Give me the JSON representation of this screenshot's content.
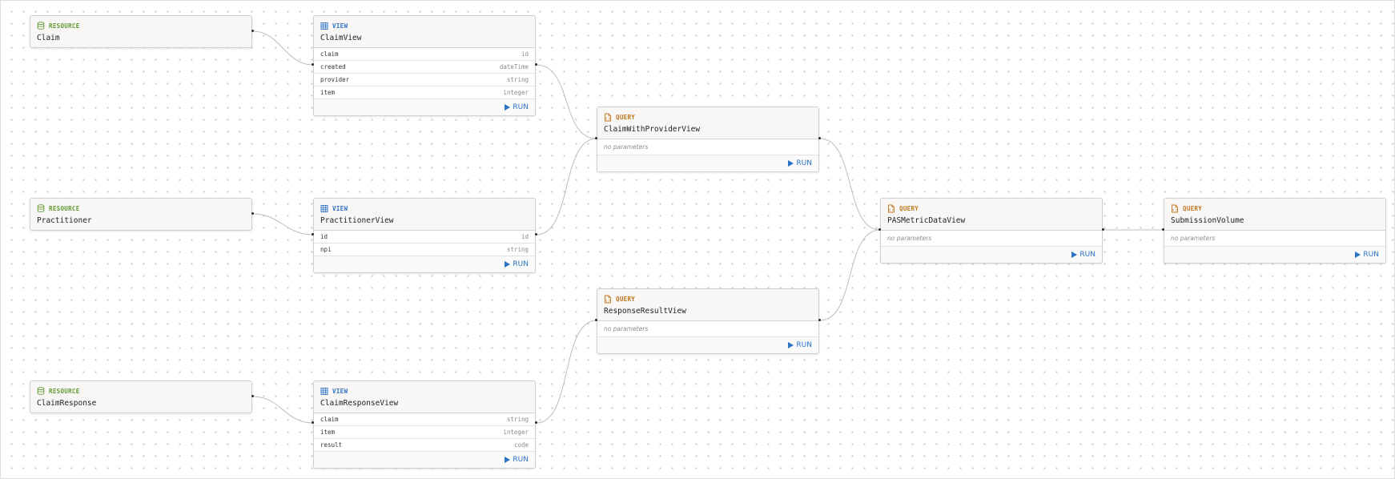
{
  "labels": {
    "resource": "RESOURCE",
    "view": "VIEW",
    "query": "QUERY",
    "run": "RUN",
    "no_params": "no parameters"
  },
  "resources": [
    {
      "name": "Claim"
    },
    {
      "name": "Practitioner"
    },
    {
      "name": "ClaimResponse"
    }
  ],
  "views": [
    {
      "name": "ClaimView",
      "fields": [
        {
          "name": "claim",
          "type": "id"
        },
        {
          "name": "created",
          "type": "dateTime"
        },
        {
          "name": "provider",
          "type": "string"
        },
        {
          "name": "item",
          "type": "integer"
        }
      ]
    },
    {
      "name": "PractitionerView",
      "fields": [
        {
          "name": "id",
          "type": "id"
        },
        {
          "name": "npi",
          "type": "string"
        }
      ]
    },
    {
      "name": "ClaimResponseView",
      "fields": [
        {
          "name": "claim",
          "type": "string"
        },
        {
          "name": "item",
          "type": "integer"
        },
        {
          "name": "result",
          "type": "code"
        }
      ]
    }
  ],
  "queries": [
    {
      "name": "ClaimWithProviderView"
    },
    {
      "name": "ResponseResultView"
    },
    {
      "name": "PASMetricDataView"
    },
    {
      "name": "SubmissionVolume"
    }
  ],
  "colors": {
    "resource": "#5f9a2e",
    "view": "#2a72c4",
    "query": "#c0761c",
    "run": "#2a72c4"
  },
  "icons": {
    "resource": "database-icon",
    "view": "table-icon",
    "query": "query-file-icon",
    "run": "play-icon"
  }
}
